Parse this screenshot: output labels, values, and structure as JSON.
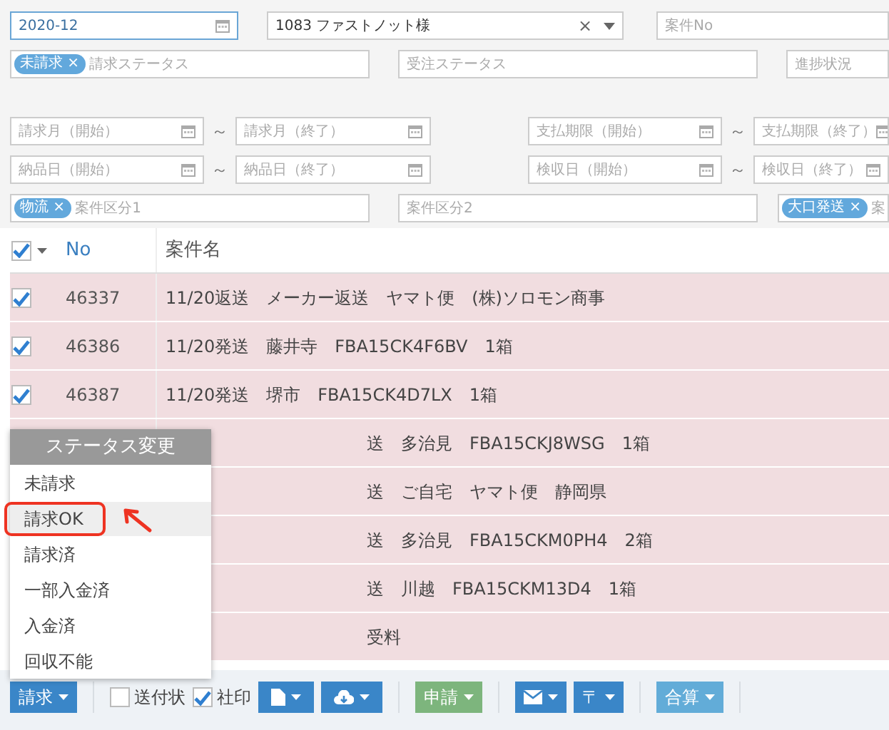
{
  "filters": {
    "rows": [
      [
        {
          "kind": "date",
          "value": "2020-12",
          "focused": true
        },
        {
          "kind": "select",
          "value": "1083 ファストノット様",
          "clear": "×"
        },
        {
          "kind": "text",
          "placeholder": "案件No"
        }
      ],
      [
        {
          "kind": "tags",
          "tags": [
            {
              "label": "未請求",
              "remove": "×"
            }
          ],
          "placeholder": "請求ステータス"
        },
        {
          "kind": "tags",
          "placeholder": "受注ステータス"
        },
        {
          "kind": "tags",
          "placeholder": "進捗状況"
        }
      ],
      [
        {
          "kind": "date",
          "placeholder": "請求月（開始）"
        },
        {
          "kind": "separator",
          "text": "～"
        },
        {
          "kind": "date",
          "placeholder": "請求月（終了）"
        },
        {
          "kind": "date",
          "placeholder": "支払期限（開始）"
        },
        {
          "kind": "separator",
          "text": "～"
        },
        {
          "kind": "date",
          "placeholder": "支払期限（終了）"
        }
      ],
      [
        {
          "kind": "date",
          "placeholder": "納品日（開始）"
        },
        {
          "kind": "separator",
          "text": "～"
        },
        {
          "kind": "date",
          "placeholder": "納品日（終了）"
        },
        {
          "kind": "date",
          "placeholder": "検収日（開始）"
        },
        {
          "kind": "separator",
          "text": "～"
        },
        {
          "kind": "date",
          "placeholder": "検収日（終了）"
        }
      ],
      [
        {
          "kind": "tags",
          "tags": [
            {
              "label": "物流",
              "remove": "×"
            }
          ],
          "placeholder": "案件区分1"
        },
        {
          "kind": "tags",
          "placeholder": "案件区分2"
        },
        {
          "kind": "tags",
          "tags": [
            {
              "label": "大口発送",
              "remove": "×"
            }
          ],
          "placeholder": "案"
        }
      ]
    ]
  },
  "table": {
    "all_checked": true,
    "columns": [
      "No",
      "案件名"
    ],
    "rows": [
      {
        "kind": "row",
        "checked": true,
        "no": "46337",
        "name": "11/20返送　メーカー返送　ヤマト便　(株)ソロモン商事"
      },
      {
        "kind": "row",
        "checked": true,
        "no": "46386",
        "name": "11/20発送　藤井寺　FBA15CK4F6BV　1箱"
      },
      {
        "kind": "row",
        "checked": true,
        "no": "46387",
        "name": "11/20発送　堺市　FBA15CK4D7LX　1箱"
      },
      {
        "kind": "covered",
        "name": "送　多治見　FBA15CKJ8WSG　1箱"
      },
      {
        "kind": "covered",
        "name": "送　ご自宅　ヤマト便　静岡県"
      },
      {
        "kind": "covered",
        "name": "送　多治見　FBA15CKM0PH4　2箱"
      },
      {
        "kind": "covered",
        "name": "送　川越　FBA15CKM13D4　1箱"
      },
      {
        "kind": "covered",
        "name": "受料"
      }
    ]
  },
  "status_menu": {
    "title": "ステータス変更",
    "items": [
      {
        "label": "未請求",
        "selected": false
      },
      {
        "label": "請求OK",
        "selected": true
      },
      {
        "label": "請求済",
        "selected": false
      },
      {
        "label": "一部入金済",
        "selected": false
      },
      {
        "label": "入金済",
        "selected": false
      },
      {
        "label": "回収不能",
        "selected": false
      }
    ]
  },
  "toolbar": [
    {
      "kind": "dropdown",
      "label": "請求"
    },
    {
      "kind": "separator"
    },
    {
      "kind": "checkbox",
      "label": "送付状",
      "checked": false
    },
    {
      "kind": "checkbox",
      "label": "社印",
      "checked": true
    },
    {
      "kind": "icon"
    },
    {
      "kind": "icon"
    },
    {
      "kind": "separator"
    },
    {
      "kind": "dropdown",
      "label": "申請"
    },
    {
      "kind": "separator"
    },
    {
      "kind": "icon"
    },
    {
      "kind": "dropdown",
      "label": "〒"
    },
    {
      "kind": "separator"
    },
    {
      "kind": "dropdown",
      "label": "合算"
    },
    {
      "kind": "separator"
    }
  ]
}
